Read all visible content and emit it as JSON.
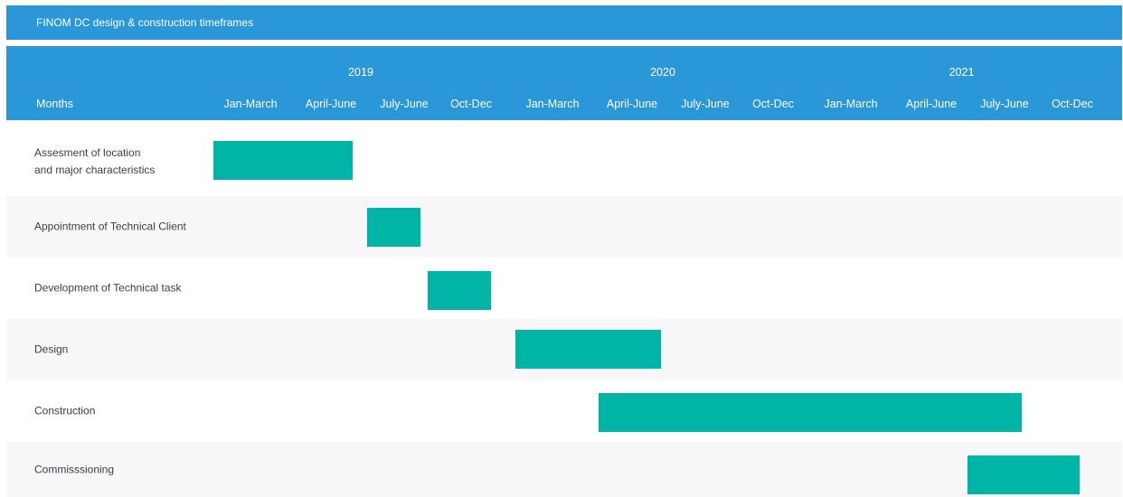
{
  "title": "FINOM DC design & construction timeframes",
  "months_label": "Months",
  "colors": {
    "header": "#2a97d8",
    "bar": "#00b5a5",
    "alt_row": "#f7f7f7"
  },
  "chart_data": {
    "type": "gantt",
    "title": "FINOM DC design & construction timeframes",
    "years": [
      "2019",
      "2020",
      "2021"
    ],
    "periods": [
      "Jan-March",
      "April-June",
      "July-June",
      "Oct-Dec",
      "Jan-March",
      "April-June",
      "July-June",
      "Oct-Dec",
      "Jan-March",
      "April-June",
      "July-June",
      "Oct-Dec"
    ],
    "tasks": [
      {
        "name": "Assesment of location\nand major characteristics",
        "start": 0.0,
        "end": 1.8
      },
      {
        "name": "Appointment of Technical Client",
        "start": 2.0,
        "end": 2.8
      },
      {
        "name": "Development of Technical task",
        "start": 2.9,
        "end": 3.7
      },
      {
        "name": "Design",
        "start": 4.0,
        "end": 5.9
      },
      {
        "name": "Construction",
        "start": 5.05,
        "end": 10.8
      },
      {
        "name": "Commisssioning",
        "start": 10.0,
        "end": 11.6
      }
    ]
  }
}
